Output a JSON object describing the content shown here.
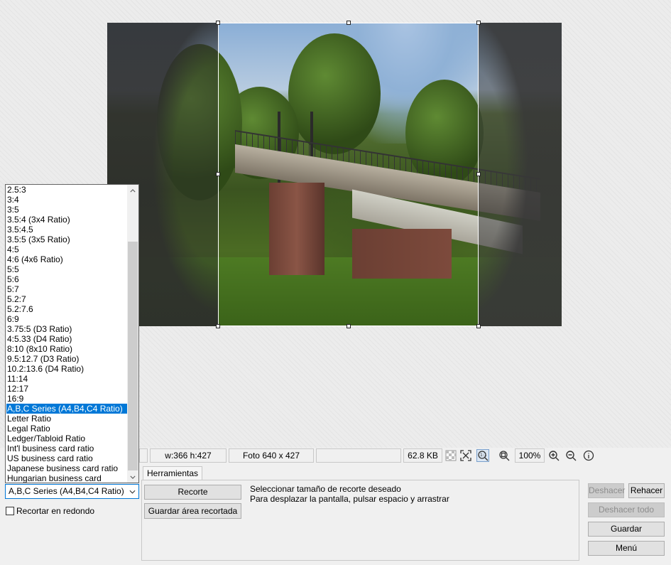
{
  "statusbar": {
    "dimensions": "w:366 h:427",
    "photo_size": "Foto 640 x 427",
    "file_size": "62.8 KB",
    "zoom": "100%",
    "icons": [
      "transparency-icon",
      "fit-screen-icon",
      "actual-size-icon",
      "zoom-fit-icon",
      "zoom-in-icon",
      "zoom-out-icon",
      "info-icon"
    ]
  },
  "tabs": {
    "tools": "Herramientas"
  },
  "crop": {
    "selected_ratio": "A,B,C Series (A4,B4,C4 Ratio)",
    "round_label": "Recortar en redondo",
    "crop_button": "Recorte",
    "save_area_button": "Guardar área recortada",
    "info_line_1": "Seleccionar tamaño de recorte deseado",
    "info_line_2": "Para desplazar la pantalla, pulsar espacio y arrastrar"
  },
  "actions": {
    "undo": "Deshacer",
    "redo": "Rehacer",
    "undo_all": "Deshacer todo",
    "save": "Guardar",
    "menu": "Menú"
  },
  "ratio_list": [
    "2.5:3",
    "3:4",
    "3:5",
    "3.5:4 (3x4 Ratio)",
    "3.5:4.5",
    "3.5:5 (3x5 Ratio)",
    "4:5",
    "4:6 (4x6 Ratio)",
    "5:5",
    "5:6",
    "5:7",
    "5.2:7",
    "5.2:7.6",
    "6:9",
    "3.75:5 (D3 Ratio)",
    "4:5.33 (D4 Ratio)",
    "8:10 (8x10 Ratio)",
    "9.5:12.7 (D3 Ratio)",
    "10.2:13.6 (D4 Ratio)",
    "11:14",
    "12:17",
    "16:9",
    "A,B,C Series (A4,B4,C4 Ratio)",
    "Letter Ratio",
    "Legal Ratio",
    "Ledger/Tabloid Ratio",
    "Int'l business card ratio",
    "US business card ratio",
    "Japanese business card ratio",
    "Hungarian business card"
  ],
  "ratio_selected_index": 22
}
